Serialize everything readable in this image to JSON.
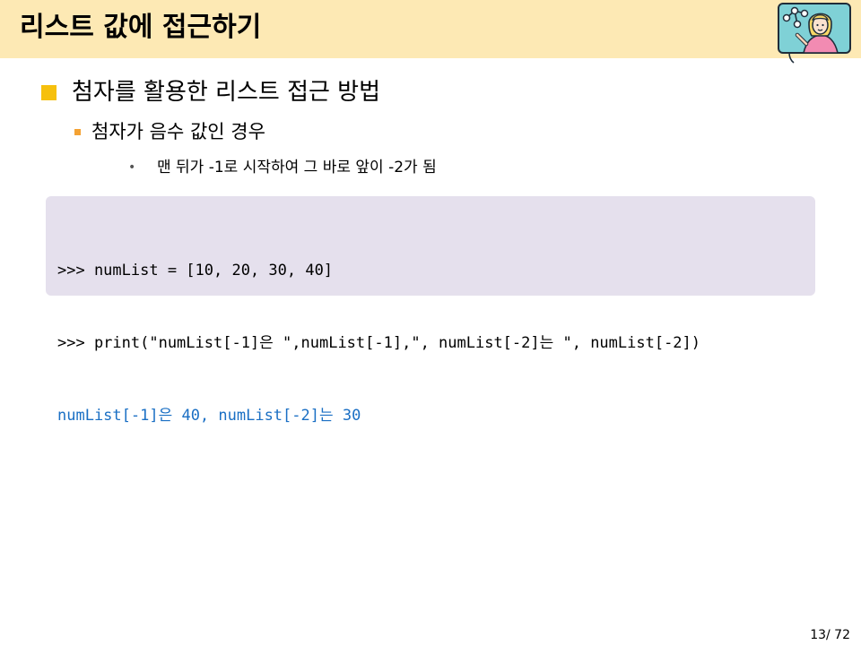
{
  "slide": {
    "title": "리스트 값에 접근하기",
    "heading": "첨자를 활용한 리스트 접근 방법",
    "subheading": "첨자가 음수 값인 경우",
    "detail": "맨 뒤가 -1로 시작하여 그 바로 앞이 -2가 됨"
  },
  "code": {
    "lines": [
      ">>> numList = [10, 20, 30, 40]",
      ">>> print(\"numList[-1]은 \",numList[-1],\", numList[-2]는 \", numList[-2])",
      "numList[-1]은 40, numList[-2]는 30"
    ]
  },
  "footer": {
    "page": "13/ 72"
  },
  "colors": {
    "header_bg": "#fde9b4",
    "code_bg": "#e5e0ed",
    "output_text": "#1a6fc4",
    "bullet_level1": "#f6c00d",
    "bullet_level2": "#f4a233"
  },
  "icons": {
    "header_illustration": "teacher-pointing-at-board-icon"
  }
}
